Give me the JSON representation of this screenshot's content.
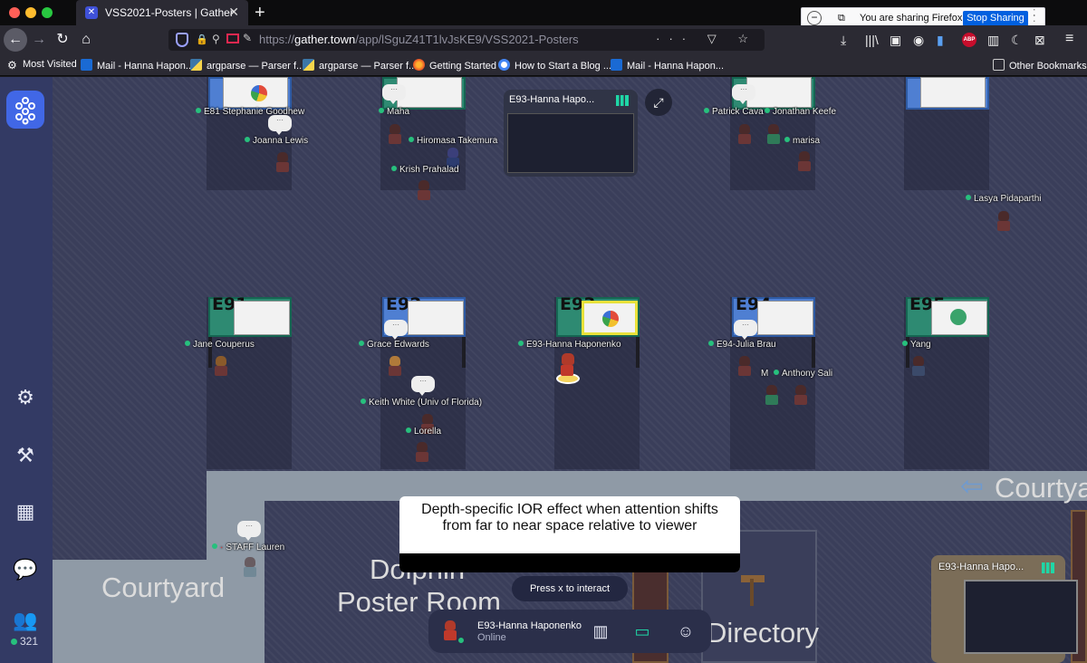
{
  "browser": {
    "tab_title": "VSS2021-Posters | Gather",
    "url_host": "gather.town",
    "url_prefix": "https://",
    "url_path": "/app/lSguZ41T1lvJsKE9/VSS2021-Posters",
    "share_text": "You are sharing Firefox.",
    "stop_sharing_label": "Stop Sharing",
    "abp_label": "ABP",
    "bookmarks": [
      {
        "label": "Most Visited",
        "icon": "gear-icon"
      },
      {
        "label": "Mail - Hanna Hapon...",
        "icon": "outlook-icon"
      },
      {
        "label": "argparse — Parser f...",
        "icon": "python-icon"
      },
      {
        "label": "argparse — Parser f...",
        "icon": "python-icon"
      },
      {
        "label": "Getting Started",
        "icon": "firefox-icon"
      },
      {
        "label": "How to Start a Blog ...",
        "icon": "google-icon"
      },
      {
        "label": "Mail - Hanna Hapon...",
        "icon": "outlook-icon"
      }
    ],
    "other_bookmarks": "Other Bookmarks"
  },
  "sidebar": {
    "online_count": "321"
  },
  "booths": [
    {
      "label": "E91"
    },
    {
      "label": "E92"
    },
    {
      "label": "E93"
    },
    {
      "label": "E94"
    },
    {
      "label": "E95"
    }
  ],
  "people": {
    "p1": "E81 Stephanie Goodhew",
    "p2": "Joanna Lewis",
    "p3": "Maha",
    "p4": "Hiromasa Takemura",
    "p5": "Krish Prahalad",
    "p6": "Patrick Cava",
    "p7": "Jonathan Keefe",
    "p8": "marisa",
    "p9": "Lasya Pidaparthi",
    "p10": "Jane Couperus",
    "p11": "Grace Edwards",
    "p12": "E93-Hanna Haponenko",
    "p13": "E94-Julia Brau",
    "p14": "Yang",
    "p15": "M",
    "p16": "Anthony Sali",
    "p17": "Keith White (Univ of Florida)",
    "p18": "Lorella",
    "p19": "STAFF Lauren"
  },
  "map_labels": {
    "courtyard_left": "Courtyard",
    "courtyard_right": "Courtya",
    "dolphin_line1": "Dolphin",
    "dolphin_line2": "Poster Room",
    "directory": "Directory"
  },
  "video": {
    "main_label": "E93-Hanna Hapo...",
    "mini_label": "E93-Hanna Hapo..."
  },
  "popup": {
    "title": "Depth-specific IOR effect when attention shifts from far to near space relative to viewer"
  },
  "interact_hint": "Press x to interact",
  "user": {
    "name": "E93-Hanna Haponenko",
    "status": "Online"
  },
  "colors": {
    "accent": "#4167e6",
    "online": "#27c07d",
    "stop_sharing": "#0060df"
  }
}
